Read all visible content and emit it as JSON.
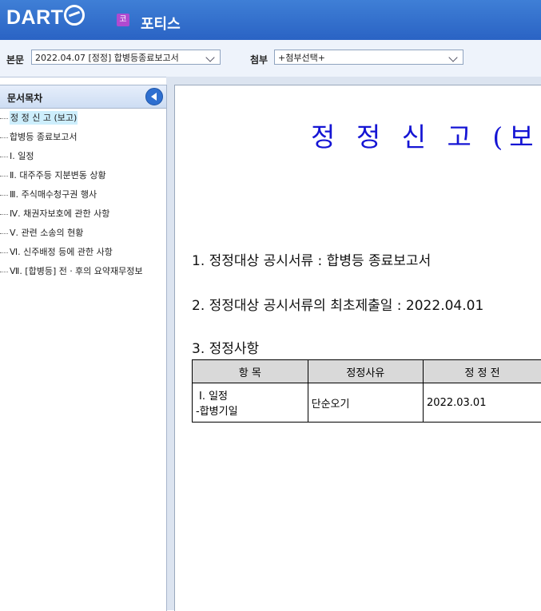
{
  "header": {
    "logo_text": "DART",
    "company_badge": "코",
    "company_name": "포티스"
  },
  "toolbar": {
    "main_label": "본문",
    "main_value": "2022.04.07 [정정] 합병등종료보고서",
    "attach_label": "첨부",
    "attach_value": "+첨부선택+"
  },
  "sidebar": {
    "title": "문서목차",
    "items": [
      "정 정 신 고 (보고)",
      "합병등 종료보고서",
      "Ⅰ. 일정",
      "Ⅱ. 대주주등 지분변동 상황",
      "Ⅲ. 주식매수청구권 행사",
      "Ⅳ. 채권자보호에 관한 사항",
      "Ⅴ. 관련 소송의 현황",
      "Ⅵ. 신주배정 등에 관한 사항",
      "Ⅶ. [합병등] 전ㆍ후의 요약재무정보"
    ]
  },
  "document": {
    "title": "정 정 신 고 (보고)",
    "section1": "1. 정정대상 공시서류 : 합병등 종료보고서",
    "section2": "2. 정정대상 공시서류의 최초제출일 : 2022.04.01",
    "section3": "3. 정정사항",
    "table": {
      "headers": [
        "항 목",
        "정정사유",
        "정 정 전"
      ],
      "row": {
        "item_line1": "Ⅰ. 일정",
        "item_line2": "-합병기일",
        "reason": "단순오기",
        "before": "2022.03.01"
      }
    }
  }
}
